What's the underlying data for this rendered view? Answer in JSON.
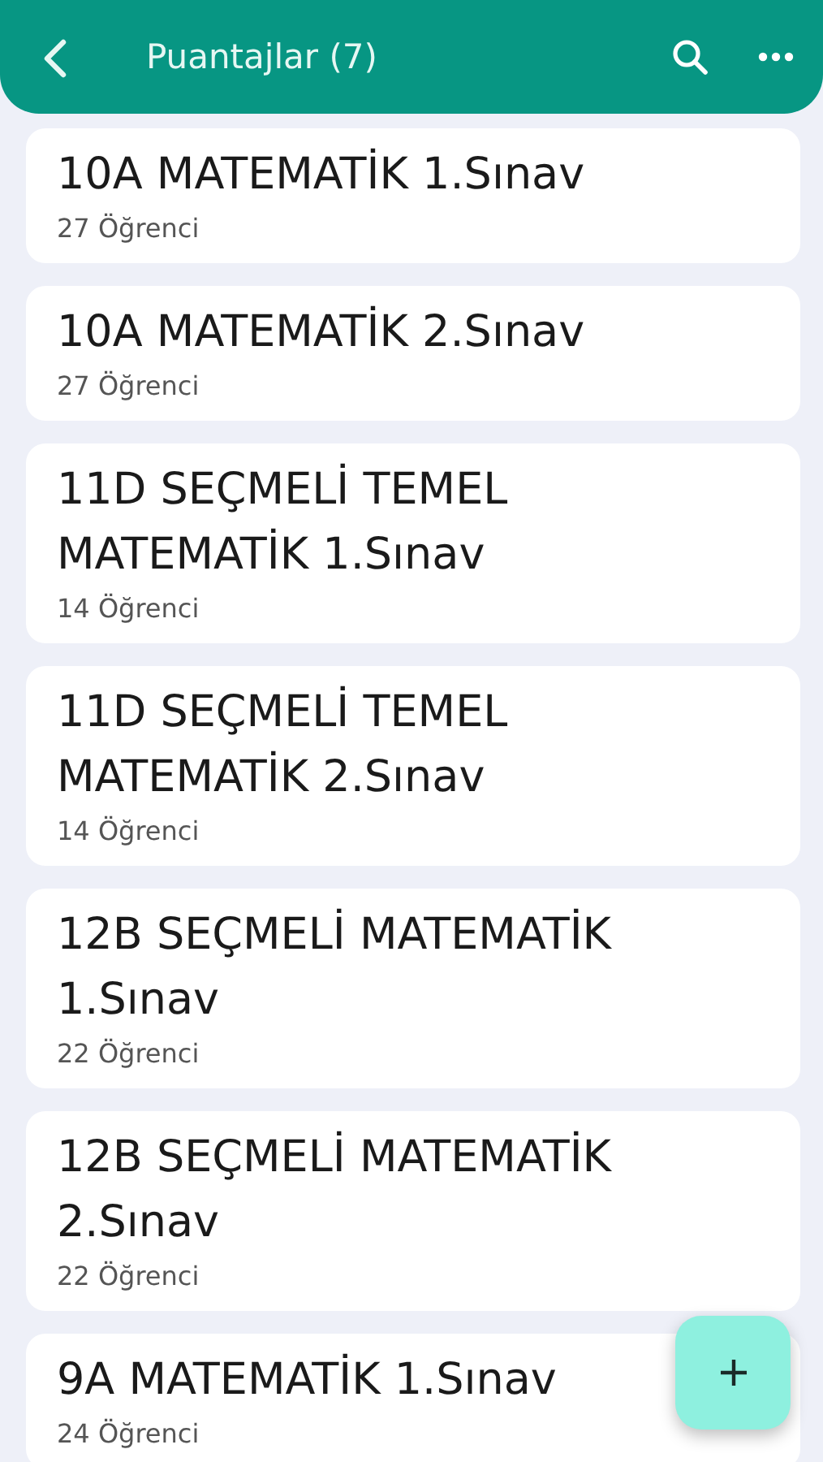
{
  "header": {
    "title": "Puantajlar (7)"
  },
  "items": [
    {
      "title": "10A MATEMATİK 1.Sınav",
      "subtitle": "27 Öğrenci"
    },
    {
      "title": "10A MATEMATİK 2.Sınav",
      "subtitle": "27 Öğrenci"
    },
    {
      "title": "11D SEÇMELİ TEMEL MATEMATİK 1.Sınav",
      "subtitle": "14 Öğrenci"
    },
    {
      "title": "11D SEÇMELİ TEMEL MATEMATİK 2.Sınav",
      "subtitle": "14 Öğrenci"
    },
    {
      "title": "12B SEÇMELİ MATEMATİK 1.Sınav",
      "subtitle": "22 Öğrenci"
    },
    {
      "title": "12B SEÇMELİ MATEMATİK 2.Sınav",
      "subtitle": "22 Öğrenci"
    },
    {
      "title": "9A MATEMATİK 1.Sınav",
      "subtitle": "24 Öğrenci"
    }
  ]
}
